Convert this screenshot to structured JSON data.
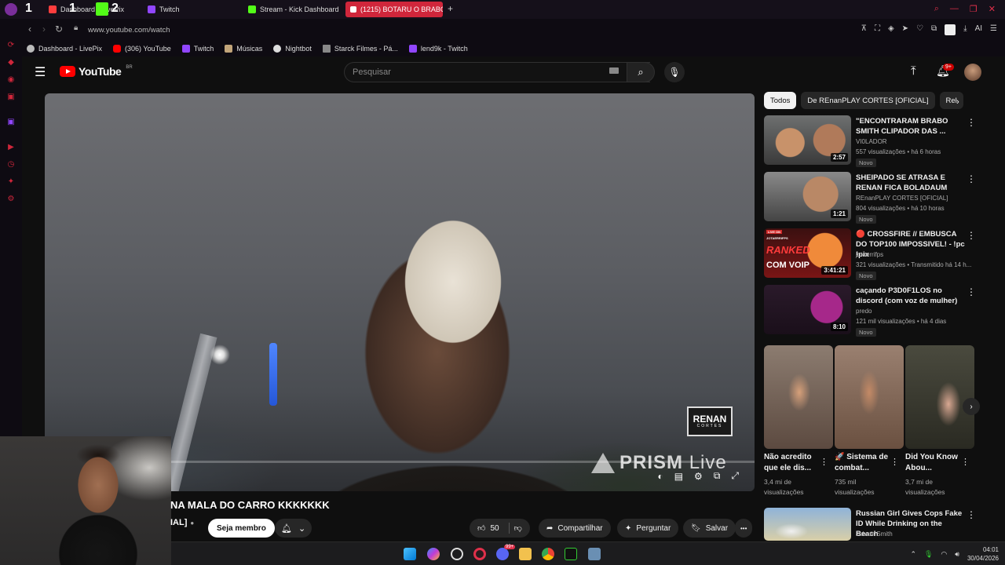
{
  "browser": {
    "tabs": [
      {
        "label": "Dashboard - LivePix",
        "color": "#ff3d3d"
      },
      {
        "label": "Twitch",
        "color": "#9146ff"
      },
      {
        "label": "Stream - Kick Dashboard",
        "color": "#53fc18"
      },
      {
        "label": "(1215) BOTARU O BRABO",
        "color": "#ffffff"
      }
    ],
    "overlay_labels": [
      "1",
      "1",
      "2"
    ],
    "new_tab": "+",
    "url": "www.youtube.com/watch",
    "bookmarks": [
      {
        "label": "Dashboard - LivePix",
        "color": "#bbbbbb"
      },
      {
        "label": "(306) YouTube",
        "color": "#ff0000"
      },
      {
        "label": "Twitch",
        "color": "#9146ff"
      },
      {
        "label": "Músicas",
        "color": "#c2a57a"
      },
      {
        "label": "Nightbot",
        "color": "#dddddd"
      },
      {
        "label": "Starck Filmes - Pá...",
        "color": "#888888"
      },
      {
        "label": "lend9k - Twitch",
        "color": "#9146ff"
      }
    ],
    "ai_label": "AI"
  },
  "youtube": {
    "logo_text": "YouTube",
    "region": "BR",
    "search_placeholder": "Pesquisar",
    "notification_count": "9+"
  },
  "player": {
    "watermark": "PRISM Live",
    "watermark_bold": "PRISM",
    "watermark_light": "Live",
    "channel_logo": "RENAN",
    "channel_logo_sub": "CORTES"
  },
  "video": {
    "title": "NA MALA DO CARRO KKKKKKK",
    "channel_partial": "IAL]",
    "member_button": "Seja membro",
    "likes": "50",
    "share": "Compartilhar",
    "ask": "Perguntar",
    "save": "Salvar",
    "more": "•••"
  },
  "sidebar": {
    "chips": [
      "Todos",
      "De REnanPLAY CORTES [OFICIAL]",
      "Rel"
    ],
    "recommendations": [
      {
        "title": "\"ENCONTRARAM BRABO SMITH CLIPADOR DAS ...",
        "channel": "VI0LADOR",
        "meta": "557 visualizações • há 6 horas",
        "badge": "Novo",
        "duration": "2:57"
      },
      {
        "title": "SHEIPADO SE ATRASA E RENAN FICA BOLADAUM",
        "channel": "REnanPLAY CORTES [OFICIAL]",
        "meta": "804 visualizações • há 10 horas",
        "badge": "Novo",
        "duration": "1:21"
      },
      {
        "title": "🔴 CROSSFIRE // EMBUSCA DO TOP100 IMPOSSIVEL! - !pc !pix",
        "channel": "jotaerrifps",
        "meta": "321 visualizações • Transmitido há 14 h...",
        "badge": "Novo",
        "duration": "3:41:21"
      },
      {
        "title": "caçando P3D0F1LOS no discord (com voz de mulher)",
        "channel": "predo",
        "meta": "121 mil visualizações • há 4 dias",
        "badge": "Novo",
        "duration": "8:10"
      },
      {
        "title": "Russian Girl Gives Cops Fake ID While Drinking on the Beach",
        "channel": "Johnth Smith",
        "meta": "",
        "badge": "",
        "duration": ""
      }
    ],
    "thumb_texts": [
      "JOTAERRIFPS",
      "RANKED",
      "COM VOIP",
      "LIVE ON"
    ],
    "shorts": [
      {
        "title": "Não acredito que ele dis...",
        "views": "3,4 mi de visualizações"
      },
      {
        "title": "🚀 Sistema de combat...",
        "views": "735 mil visualizações"
      },
      {
        "title": "Did You Know Abou...",
        "views": "3,7 mi de visualizações"
      }
    ]
  },
  "taskbar": {
    "time": "04:01",
    "date": "30/04/2026",
    "discord_badge": "99+"
  },
  "colors": {
    "accent": "#ff0000",
    "opera_red": "#d0263b",
    "bg": "#0f0f0f"
  }
}
